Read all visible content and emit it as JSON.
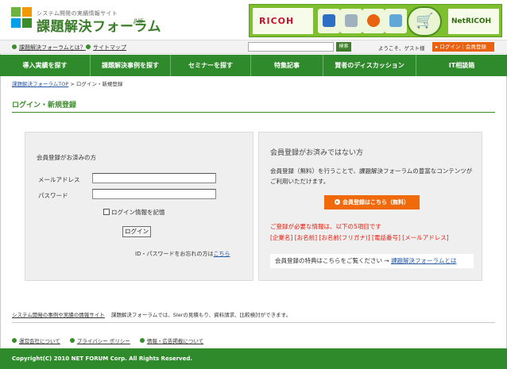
{
  "header": {
    "logo_tagline": "システム開発の実績情報サイト",
    "logo_title": "課題解決フォーラム",
    "logo_beta": "β版",
    "banner_brand": "RICOH",
    "banner_service": "NetRICOH"
  },
  "utilbar": {
    "about_link": "課題解決フォーラムとは？",
    "sitemap_link": "サイトマップ",
    "search_placeholder": "",
    "search_button": "検索",
    "welcome": "ようこそ、ゲスト様",
    "login_button": "ログイン｜会員登録"
  },
  "nav": {
    "items": [
      "導入実績を探す",
      "課題解決事例を探す",
      "セミナーを探す",
      "特集記事",
      "賢者のディスカッション",
      "IT相談箱"
    ]
  },
  "breadcrumb": {
    "home": "課題解決フォーラムTOP",
    "sep": ">",
    "current": "ログイン・新規登録"
  },
  "page_title": "ログイン・新規登録",
  "login_panel": {
    "heading": "会員登録がお済みの方",
    "email_label": "メールアドレス",
    "password_label": "パスワード",
    "remember_label": "ログイン情報を記憶",
    "login_button": "ログイン",
    "forgot_text": "ID・パスワードをお忘れの方は",
    "forgot_link": "こちら"
  },
  "register_panel": {
    "heading": "会員登録がお済みではない方",
    "desc": "会員登録（無料）を行うことで、課題解決フォーラムの豊富なコンテンツがご利用いただけます。",
    "register_button": "会員登録はこちら（無料）",
    "required_intro": "ご登録が必要な情報は、以下の5項目です",
    "required_items": "[企業名] [お名前] [お名前(フリガナ)] [電話番号] [メールアドレス]",
    "benefit_text": "会員登録の特典はこちらをご覧ください →",
    "benefit_link": "課題解決フォーラムとは"
  },
  "footer": {
    "site_desc_link": "システム開発の事例や実績の情報サイト",
    "site_desc_text": "課題解決フォーラムでは、SIerの見積もり、資料請求、比較検討ができます。",
    "links": [
      "運営会社について",
      "プライバシー ポリシー",
      "情報・広告掲載について"
    ],
    "copyright": "Copyright(C) 2010 NET FORUM Corp. All Rights Reserved."
  },
  "colors": {
    "brand_green": "#2f8a2b",
    "accent_orange": "#f06a0c",
    "link_blue": "#2a5aa6",
    "required_red": "#e02010"
  }
}
